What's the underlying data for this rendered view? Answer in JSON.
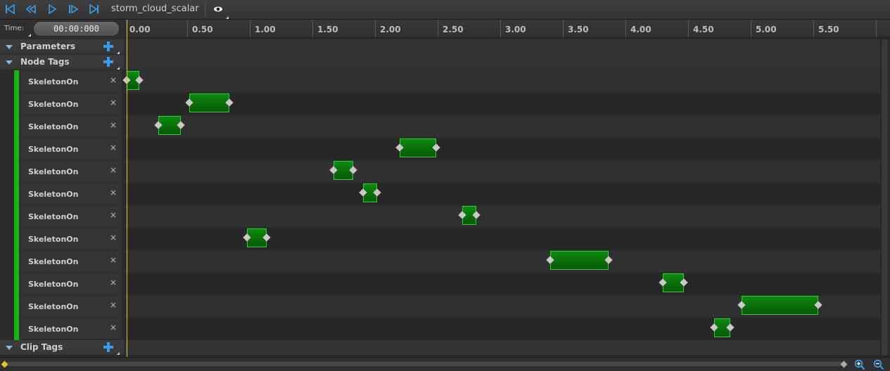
{
  "toolbar": {
    "buttons": [
      {
        "name": "go-to-start-icon"
      },
      {
        "name": "step-back-icon"
      },
      {
        "name": "play-icon"
      },
      {
        "name": "step-forward-icon"
      },
      {
        "name": "go-to-end-icon"
      }
    ],
    "clip_name": "storm_cloud_scalar",
    "eye_icon": "eye-icon"
  },
  "time": {
    "label": "Time:",
    "value": "00:00:000"
  },
  "sections": {
    "parameters": "Parameters",
    "node_tags": "Node Tags",
    "clip_tags": "Clip Tags"
  },
  "node_tags": [
    {
      "label": "SkeletonOn",
      "start": 0.0,
      "end": 0.1
    },
    {
      "label": "SkeletonOn",
      "start": 0.5,
      "end": 0.82
    },
    {
      "label": "SkeletonOn",
      "start": 0.25,
      "end": 0.43
    },
    {
      "label": "SkeletonOn",
      "start": 2.18,
      "end": 2.47
    },
    {
      "label": "SkeletonOn",
      "start": 1.65,
      "end": 1.81
    },
    {
      "label": "SkeletonOn",
      "start": 1.89,
      "end": 2.0
    },
    {
      "label": "SkeletonOn",
      "start": 2.68,
      "end": 2.79
    },
    {
      "label": "SkeletonOn",
      "start": 0.96,
      "end": 1.12
    },
    {
      "label": "SkeletonOn",
      "start": 3.38,
      "end": 3.85
    },
    {
      "label": "SkeletonOn",
      "start": 4.28,
      "end": 4.45
    },
    {
      "label": "SkeletonOn",
      "start": 4.91,
      "end": 5.52
    },
    {
      "label": "SkeletonOn",
      "start": 4.69,
      "end": 4.82
    }
  ],
  "ruler": {
    "ticks": [
      "0.00",
      "0.50",
      "1.00",
      "1.50",
      "2.00",
      "2.50",
      "3.00",
      "3.50",
      "4.00",
      "4.50",
      "5.00",
      "5.50"
    ],
    "unit_start": 0,
    "unit_step": 0.5
  },
  "remove_glyph": "×",
  "colors": {
    "clip_fill": "#0a7a0a",
    "tag_stripe": "#17b617",
    "playhead": "#e0c43a",
    "add_button": "#3b9be8"
  }
}
